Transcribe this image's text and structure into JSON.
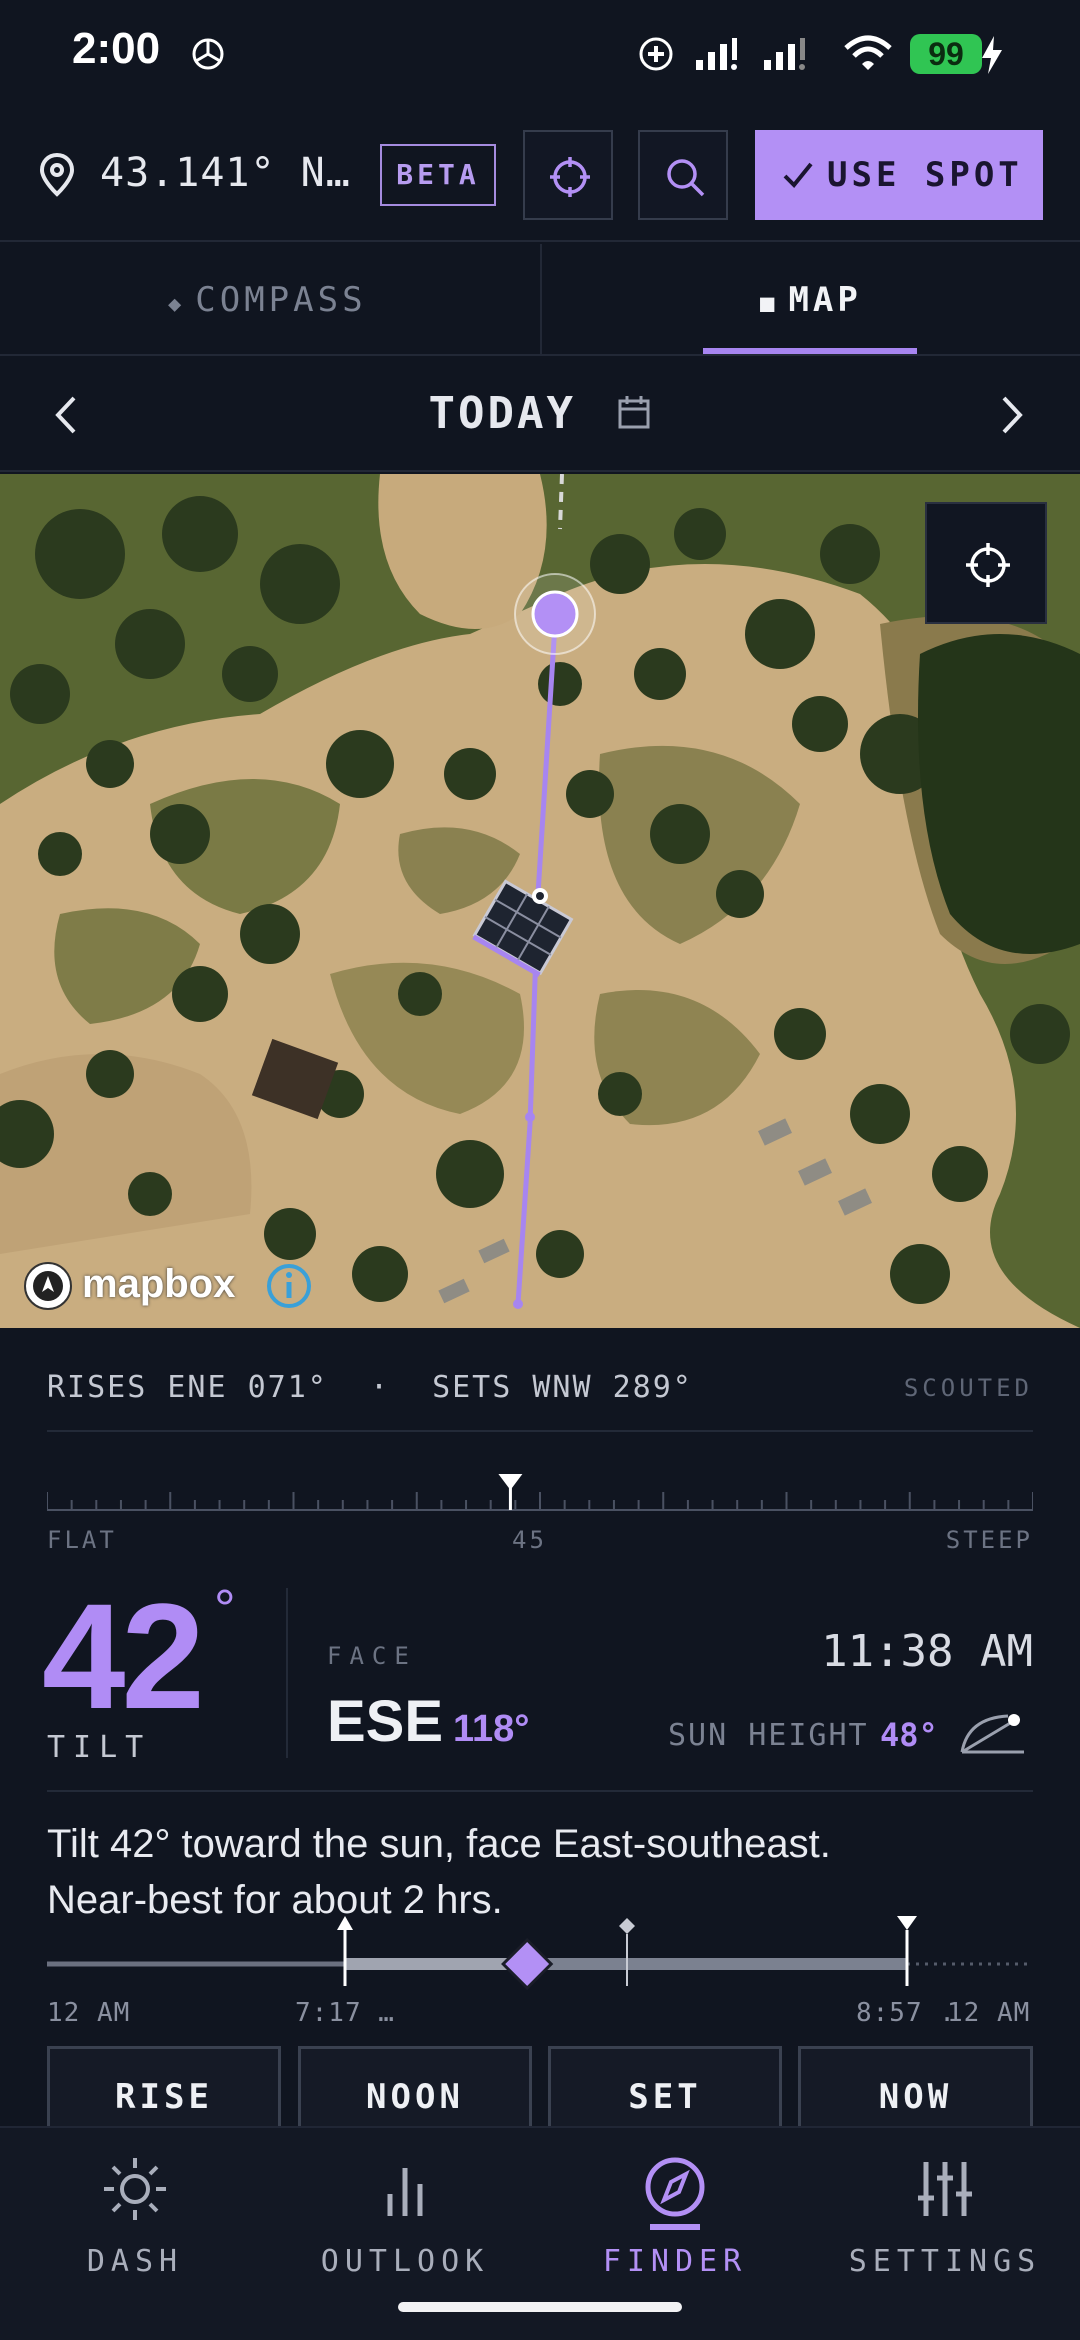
{
  "status_bar": {
    "time": "2:00",
    "battery": "99"
  },
  "top_bar": {
    "location": "43.141° N…",
    "beta_badge": "BETA",
    "use_spot_label": "USE SPOT"
  },
  "tabs": [
    {
      "label": "COMPASS",
      "active": false
    },
    {
      "label": "MAP",
      "active": true
    }
  ],
  "date_nav": {
    "label": "TODAY"
  },
  "map": {
    "attribution": "mapbox"
  },
  "sun_info": {
    "rises": "RISES ENE 071°",
    "separator": "·",
    "sets": "SETS WNW 289°",
    "scouted": "SCOUTED"
  },
  "tilt_scale": {
    "min_label": "FLAT",
    "mid_label": "45",
    "max_label": "STEEP",
    "value_fraction": 0.47
  },
  "tilt": {
    "value": "42",
    "degree_symbol": "°",
    "label": "TILT"
  },
  "face": {
    "label": "FACE",
    "direction": "ESE",
    "degrees": "118°"
  },
  "time_readout": {
    "time": "11:38 AM",
    "sun_height_label": "SUN HEIGHT",
    "sun_height_value": "48°"
  },
  "advice": {
    "line1": "Tilt 42° toward the sun, face East-southeast.",
    "line2": "Near-best for about 2 hrs."
  },
  "timeline": {
    "start_label": "12 AM",
    "rise_label": "7:17 …",
    "set_label": "8:57 .",
    "end_label": "12 AM",
    "current_fraction": 0.487
  },
  "quick_buttons": [
    "RISE",
    "NOON",
    "SET",
    "NOW"
  ],
  "bottom_nav": [
    {
      "label": "DASH",
      "icon": "sun-icon",
      "active": false
    },
    {
      "label": "OUTLOOK",
      "icon": "bar-chart-icon",
      "active": false
    },
    {
      "label": "FINDER",
      "icon": "compass-icon",
      "active": true
    },
    {
      "label": "SETTINGS",
      "icon": "sliders-icon",
      "active": false
    }
  ],
  "colors": {
    "accent": "#b390f5",
    "background": "#101520",
    "battery": "#30c553"
  }
}
